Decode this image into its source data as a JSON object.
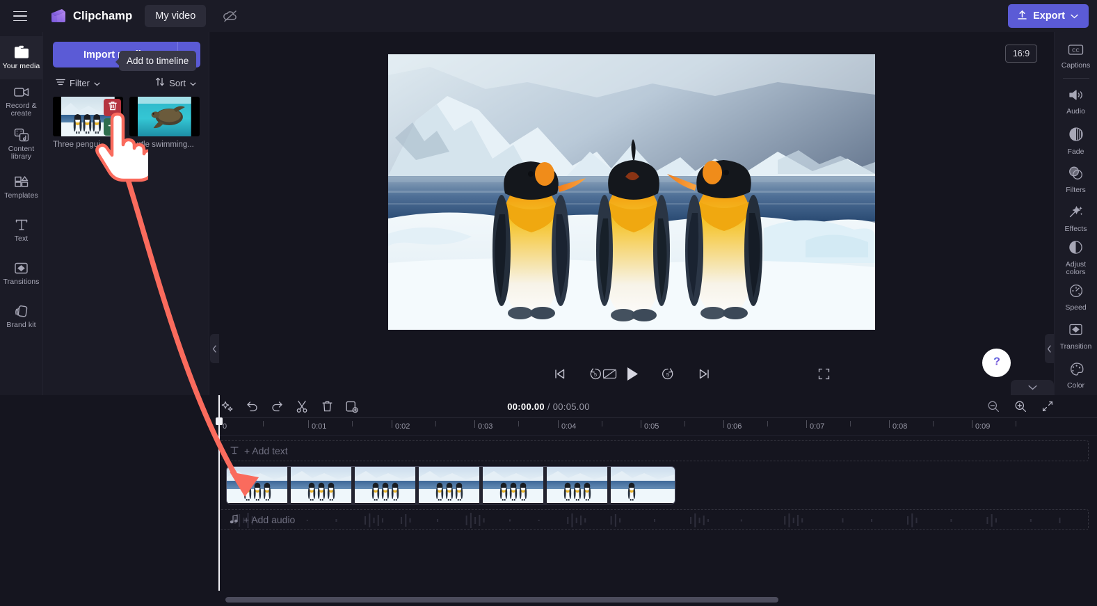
{
  "app": {
    "brand_name": "Clipchamp",
    "project_title": "My video",
    "menu_icon": "hamburger-icon",
    "cloud_icon": "cloud-off-icon",
    "export_label": "Export",
    "export_icon": "upload-icon",
    "accent_color": "#5b5bd6",
    "background_color": "#15151f",
    "panel_color": "#1b1b26"
  },
  "left_rail": {
    "items": [
      {
        "label": "Your media",
        "icon": "media-folder-icon",
        "active": true
      },
      {
        "label": "Record & create",
        "icon": "video-camera-icon",
        "active": false
      },
      {
        "label": "Content library",
        "icon": "content-library-icon",
        "active": false
      },
      {
        "label": "Templates",
        "icon": "templates-grid-icon",
        "active": false
      },
      {
        "label": "Text",
        "icon": "text-t-icon",
        "active": false
      },
      {
        "label": "Transitions",
        "icon": "transitions-icon",
        "active": false
      },
      {
        "label": "Brand kit",
        "icon": "brand-kit-icon",
        "active": false
      }
    ]
  },
  "media_panel": {
    "import_label": "Import media",
    "import_caret_icon": "chevron-down-icon",
    "filter_label": "Filter",
    "filter_icon": "filter-lines-icon",
    "sort_label": "Sort",
    "sort_icon": "sort-arrows-icon",
    "tooltip": "Add to timeline",
    "hover_delete_icon": "trash-icon",
    "hover_add_icon": "plus-icon",
    "items": [
      {
        "name": "Three pengui...",
        "thumb": "penguins"
      },
      {
        "name": "Turtle swimming...",
        "thumb": "turtle"
      }
    ]
  },
  "preview": {
    "aspect_ratio": "16:9",
    "scene_alt": "Three king penguins on ice"
  },
  "player_controls": {
    "captions_toggle_icon": "captions-off-icon",
    "skip_start_icon": "skip-to-start-icon",
    "back5_icon": "rewind-5-icon",
    "play_icon": "play-icon",
    "forward5_icon": "forward-5-icon",
    "skip_end_icon": "skip-to-end-icon",
    "fullscreen_icon": "fullscreen-icon",
    "help_icon": "question-mark-icon"
  },
  "right_rail": {
    "items": [
      {
        "label": "Captions",
        "icon": "captions-cc-icon",
        "separator_after": true
      },
      {
        "label": "Audio",
        "icon": "speaker-icon"
      },
      {
        "label": "Fade",
        "icon": "fade-circle-icon"
      },
      {
        "label": "Filters",
        "icon": "filters-overlap-icon"
      },
      {
        "label": "Effects",
        "icon": "magic-wand-icon"
      },
      {
        "label": "Adjust colors",
        "icon": "contrast-circle-icon"
      },
      {
        "label": "Speed",
        "icon": "speedometer-icon"
      },
      {
        "label": "Transition",
        "icon": "transition-icon"
      },
      {
        "label": "Color",
        "icon": "palette-icon"
      }
    ]
  },
  "timeline": {
    "tools": [
      {
        "name": "magic-sparkle-icon"
      },
      {
        "name": "undo-icon"
      },
      {
        "name": "redo-icon"
      },
      {
        "name": "split-scissors-icon"
      },
      {
        "name": "delete-trash-icon"
      },
      {
        "name": "duplicate-icon"
      }
    ],
    "current_time": "00:00.00",
    "separator": "/",
    "total_time": "00:05.00",
    "zoom_out_icon": "zoom-out-icon",
    "zoom_in_icon": "zoom-in-icon",
    "fit_icon": "fit-to-screen-icon",
    "ruler_ticks": [
      "0",
      "0:01",
      "0:02",
      "0:03",
      "0:04",
      "0:05",
      "0:06",
      "0:07",
      "0:08",
      "0:09"
    ],
    "add_text_label": "+ Add text",
    "add_text_icon": "text-t-icon",
    "add_audio_label": "+ Add audio",
    "add_audio_icon": "music-note-icon",
    "video_clip_frames": 7
  },
  "annotation": {
    "cursor_icon": "pointing-hand-cursor",
    "arrow_color": "#fa6b5d",
    "arrow_description": "arrow from media add button to timeline clip"
  }
}
